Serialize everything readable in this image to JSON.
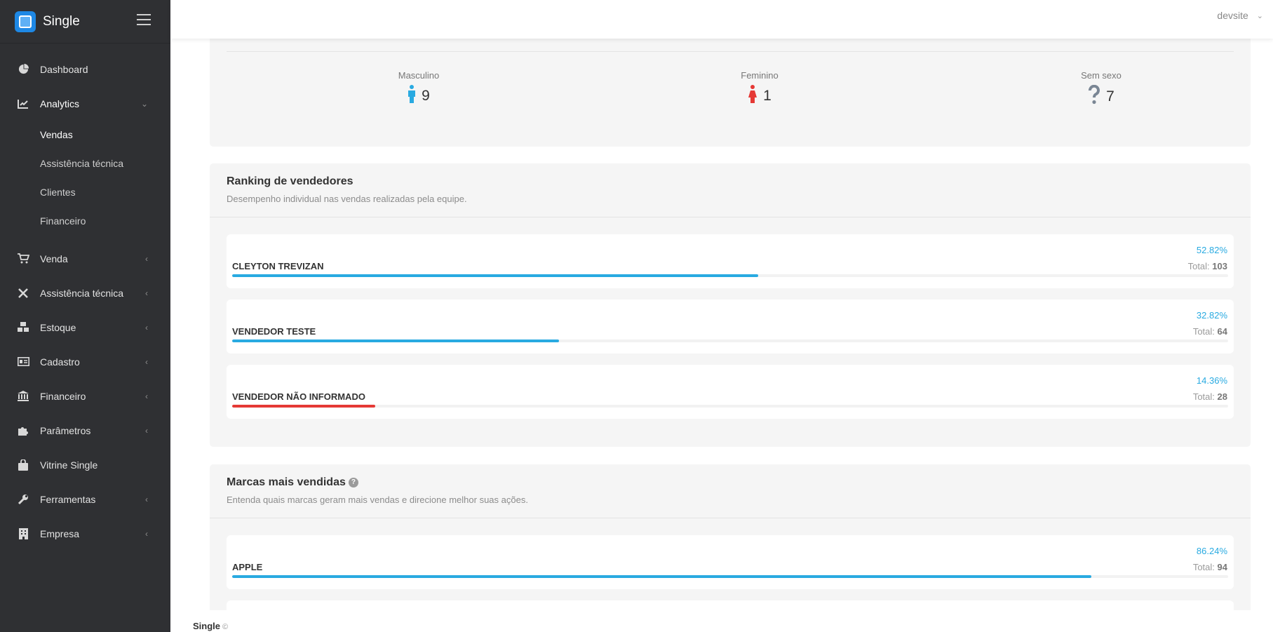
{
  "brand": {
    "name": "Single"
  },
  "topbar": {
    "user": "devsite"
  },
  "sidebar": {
    "items": [
      {
        "label": "Dashboard",
        "icon": "pie-chart-icon",
        "arrow": ""
      },
      {
        "label": "Analytics",
        "icon": "line-chart-icon",
        "arrow": "⌄",
        "open": true,
        "submenu": [
          "Vendas",
          "Assistência técnica",
          "Clientes",
          "Financeiro"
        ],
        "active": "Vendas"
      },
      {
        "label": "Venda",
        "icon": "cart-icon",
        "arrow": "‹"
      },
      {
        "label": "Assistência técnica",
        "icon": "tools-icon",
        "arrow": "‹"
      },
      {
        "label": "Estoque",
        "icon": "boxes-icon",
        "arrow": "‹"
      },
      {
        "label": "Cadastro",
        "icon": "id-card-icon",
        "arrow": "‹"
      },
      {
        "label": "Financeiro",
        "icon": "bank-icon",
        "arrow": "‹"
      },
      {
        "label": "Parâmetros",
        "icon": "puzzle-icon",
        "arrow": "‹"
      },
      {
        "label": "Vitrine Single",
        "icon": "shopping-bag-icon",
        "arrow": ""
      },
      {
        "label": "Ferramentas",
        "icon": "wrench-icon",
        "arrow": "‹"
      },
      {
        "label": "Empresa",
        "icon": "building-icon",
        "arrow": "‹"
      }
    ]
  },
  "gender": {
    "male": {
      "label": "Masculino",
      "value": "9",
      "color": "#29aae1"
    },
    "female": {
      "label": "Feminino",
      "value": "1",
      "color": "#e53935"
    },
    "none": {
      "label": "Sem sexo",
      "value": "7",
      "color": "#7a8694"
    }
  },
  "ranking": {
    "title": "Ranking de vendedores",
    "subtitle": "Desempenho individual nas vendas realizadas pela equipe.",
    "items": [
      {
        "name": "CLEYTON TREVIZAN",
        "percent": "52.82%",
        "total_label": "Total:",
        "total": "103",
        "fraction": 0.5282,
        "color": "#29aae1"
      },
      {
        "name": "VENDEDOR TESTE",
        "percent": "32.82%",
        "total_label": "Total:",
        "total": "64",
        "fraction": 0.3282,
        "color": "#29aae1"
      },
      {
        "name": "VENDEDOR NÃO INFORMADO",
        "percent": "14.36%",
        "total_label": "Total:",
        "total": "28",
        "fraction": 0.1436,
        "color": "#e53935"
      }
    ]
  },
  "brands": {
    "title": "Marcas mais vendidas",
    "help": "?",
    "subtitle": "Entenda quais marcas geram mais vendas e direcione melhor suas ações.",
    "items": [
      {
        "name": "APPLE",
        "percent": "86.24%",
        "total_label": "Total:",
        "total": "94",
        "fraction": 0.8624,
        "color": "#29aae1"
      }
    ]
  },
  "footer": {
    "brand": "Single",
    "copy": "©"
  }
}
